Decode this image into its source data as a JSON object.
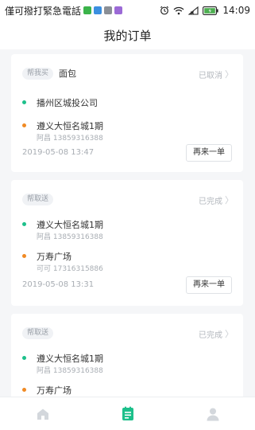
{
  "status_bar": {
    "carrier": "僅可撥打緊急電話",
    "time": "14:09"
  },
  "header": {
    "title": "我的订单"
  },
  "orders": [
    {
      "type": "帮我买",
      "goods": "面包",
      "status": "已取消",
      "addresses": [
        {
          "name": "播州区城投公司",
          "contact": "",
          "dot_color": "#1dc08b"
        },
        {
          "name": "遵义大恒名城1期",
          "contact": "阿昌 13859316388",
          "dot_color": "#f08a24"
        }
      ],
      "time": "2019-05-08 13:47",
      "action": "再来一单"
    },
    {
      "type": "帮取送",
      "goods": "",
      "status": "已完成",
      "addresses": [
        {
          "name": "遵义大恒名城1期",
          "contact": "阿昌 13859316388",
          "dot_color": "#1dc08b"
        },
        {
          "name": "万寿广场",
          "contact": "可可 17316315886",
          "dot_color": "#f08a24"
        }
      ],
      "time": "2019-05-08 13:31",
      "action": "再来一单"
    },
    {
      "type": "帮取送",
      "goods": "",
      "status": "已完成",
      "addresses": [
        {
          "name": "遵义大恒名城1期",
          "contact": "阿昌 13859316388",
          "dot_color": "#1dc08b"
        },
        {
          "name": "万寿广场",
          "contact": "",
          "dot_color": "#f08a24"
        }
      ],
      "time": "",
      "action": ""
    }
  ],
  "tab_bar": {
    "tabs": [
      {
        "icon": "home-icon",
        "active": false
      },
      {
        "icon": "orders-icon",
        "active": true
      },
      {
        "icon": "profile-icon",
        "active": false
      }
    ],
    "active_color": "#1dc08b",
    "inactive_color": "#d3d7dc"
  }
}
